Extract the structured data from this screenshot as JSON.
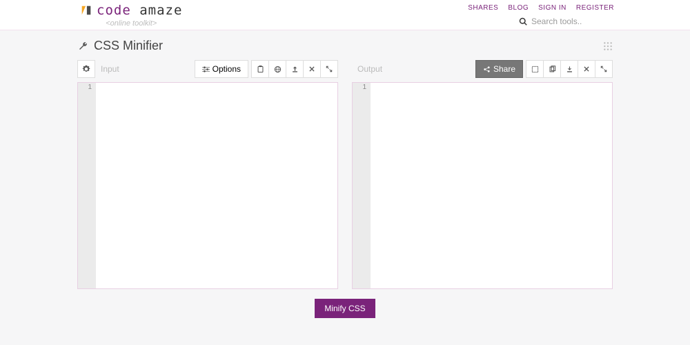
{
  "brand": {
    "word1": "code",
    "word2": "amaze",
    "tagline": "<online toolkit>"
  },
  "nav": {
    "shares": "SHARES",
    "blog": "BLOG",
    "signin": "SIGN IN",
    "register": "REGISTER"
  },
  "search": {
    "placeholder": "Search tools.."
  },
  "page": {
    "title": "CSS Minifier"
  },
  "input_panel": {
    "placeholder": "Input",
    "options_label": "Options",
    "gutter_line": "1"
  },
  "output_panel": {
    "placeholder": "Output",
    "share_label": "Share",
    "gutter_line": "1"
  },
  "action": {
    "minify": "Minify CSS"
  }
}
